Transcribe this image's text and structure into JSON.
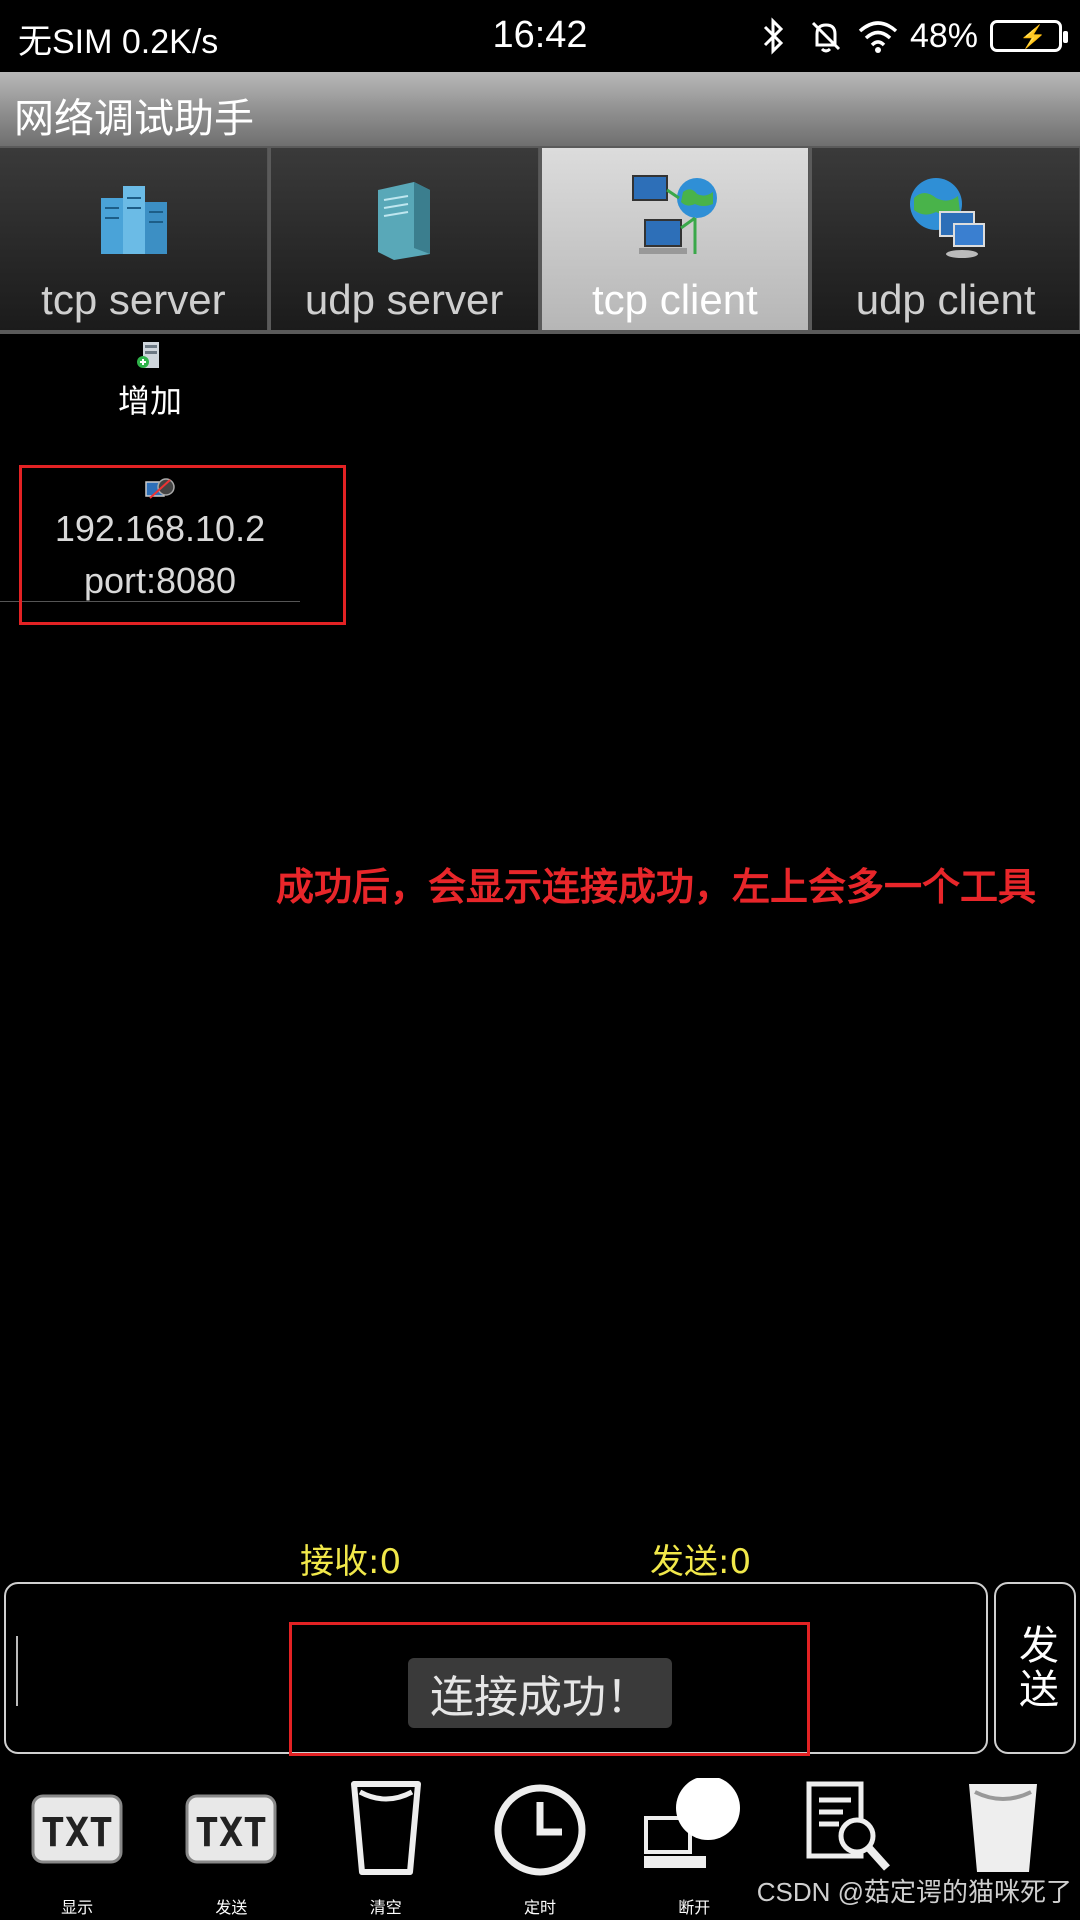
{
  "status_bar": {
    "carrier": "无SIM 0.2K/s",
    "time": "16:42",
    "battery": "48%",
    "icons": [
      "bluetooth-icon",
      "bell-muted-icon",
      "wifi-icon",
      "battery-charging-icon"
    ]
  },
  "app": {
    "title": "网络调试助手"
  },
  "tabs": [
    {
      "label": "tcp server",
      "icon": "servers-icon",
      "active": false
    },
    {
      "label": "udp server",
      "icon": "server-tower-icon",
      "active": false
    },
    {
      "label": "tcp client",
      "icon": "network-globe-icon",
      "active": true
    },
    {
      "label": "udp client",
      "icon": "globe-computers-icon",
      "active": false
    }
  ],
  "add": {
    "label": "增加",
    "icon": "add-server-icon"
  },
  "connection": {
    "ip": "192.168.10.2",
    "port": "port:8080",
    "icon": "connection-icon"
  },
  "annotation": "成功后，会显示连接成功，左上会多一个工具",
  "counters": {
    "recv": "接收:0",
    "sent": "发送:0"
  },
  "send_button": "发送",
  "toast": "连接成功！",
  "toolbar": [
    {
      "label": "显示",
      "icon": "txt-display-icon"
    },
    {
      "label": "发送",
      "icon": "txt-send-icon"
    },
    {
      "label": "清空",
      "icon": "clear-cup-icon"
    },
    {
      "label": "定时",
      "icon": "clock-icon"
    },
    {
      "label": "断开",
      "icon": "disconnect-icon"
    },
    {
      "label": "",
      "icon": "search-doc-icon"
    },
    {
      "label": "",
      "icon": "cup-filled-icon"
    }
  ],
  "watermark": "CSDN @菇定谔的猫咪死了",
  "colors": {
    "annotation": "#e8262a",
    "counters": "#f1e84a",
    "highlight_box": "#e32224"
  }
}
